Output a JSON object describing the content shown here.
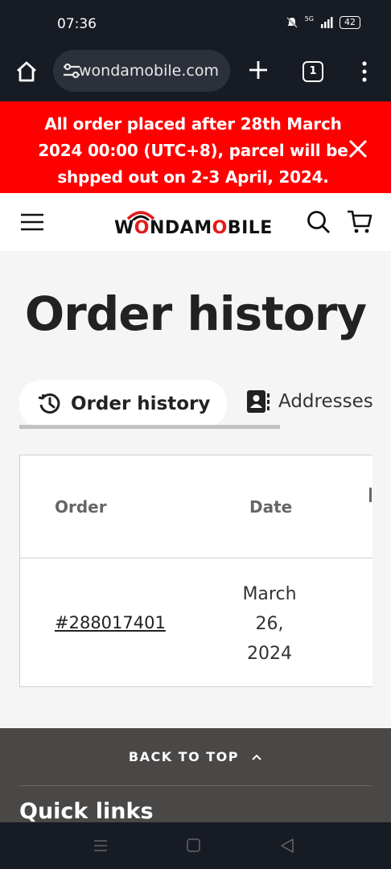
{
  "status_bar": {
    "time": "07:36",
    "network": "5G",
    "battery": "42"
  },
  "browser": {
    "url": "wondamobile.com",
    "tab_count": "1"
  },
  "announcement": {
    "text": "All order placed after 28th March 2024 00:00 (UTC+8), parcel will be shpped out on 2-3 April, 2024."
  },
  "header": {
    "logo_left": "W",
    "logo_o": "O",
    "logo_nda": "NDA",
    "logo_m": "M",
    "logo_o2": "O",
    "logo_bile": "BILE"
  },
  "main": {
    "title": "Order history",
    "tabs": [
      {
        "label": "Order history"
      },
      {
        "label": "Addresses"
      }
    ],
    "table": {
      "headers": [
        "Order",
        "Date"
      ],
      "rows": [
        {
          "order": "#288017401",
          "date_line1": "March",
          "date_line2": "26,",
          "date_line3": "2024"
        }
      ]
    }
  },
  "footer": {
    "back_to_top": "BACK TO TOP",
    "quick_links": "Quick links"
  },
  "colors": {
    "announcement_bg": "#fe0000",
    "footer_bg": "#4a4847",
    "brand_red": "#e31b1b"
  }
}
